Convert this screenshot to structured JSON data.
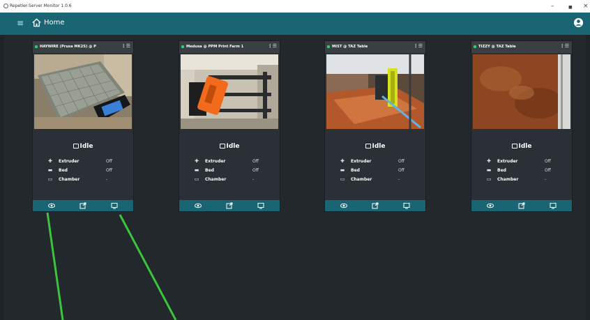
{
  "window": {
    "title": "Repetier-Server Monitor 1.0.6",
    "minimize_label": "–",
    "maximize_label": "■",
    "close_label": "×"
  },
  "appbar": {
    "title": "Home",
    "menu_glyph": "≡",
    "accent": "#1a6574"
  },
  "printers": [
    {
      "name": "HAYWIRE (Prusa MK2S) @ P",
      "state": "Idle",
      "temps": [
        {
          "label": "Extruder",
          "value": "Off",
          "icon": "extruder-icon"
        },
        {
          "label": "Bed",
          "value": "Off",
          "icon": "bed-icon"
        },
        {
          "label": "Chamber",
          "value": "-",
          "icon": "chamber-icon"
        }
      ]
    },
    {
      "name": "Medusa @ PPM Print Farm 1",
      "state": "Idle",
      "temps": [
        {
          "label": "Extruder",
          "value": "Off",
          "icon": "extruder-icon"
        },
        {
          "label": "Bed",
          "value": "Off",
          "icon": "bed-icon"
        },
        {
          "label": "Chamber",
          "value": "-",
          "icon": "chamber-icon"
        }
      ]
    },
    {
      "name": "MIST @ TAZ Table",
      "state": "Idle",
      "temps": [
        {
          "label": "Extruder",
          "value": "Off",
          "icon": "extruder-icon"
        },
        {
          "label": "Bed",
          "value": "Off",
          "icon": "bed-icon"
        },
        {
          "label": "Chamber",
          "value": "-",
          "icon": "chamber-icon"
        }
      ]
    },
    {
      "name": "TIZZY @ TAZ Table",
      "state": "Idle",
      "temps": [
        {
          "label": "Extruder",
          "value": "Off",
          "icon": "extruder-icon"
        },
        {
          "label": "Bed",
          "value": "Off",
          "icon": "bed-icon"
        },
        {
          "label": "Chamber",
          "value": "-",
          "icon": "chamber-icon"
        }
      ]
    }
  ],
  "icons": {
    "footer": [
      "eye-icon",
      "open-external-icon",
      "monitor-icon"
    ]
  }
}
